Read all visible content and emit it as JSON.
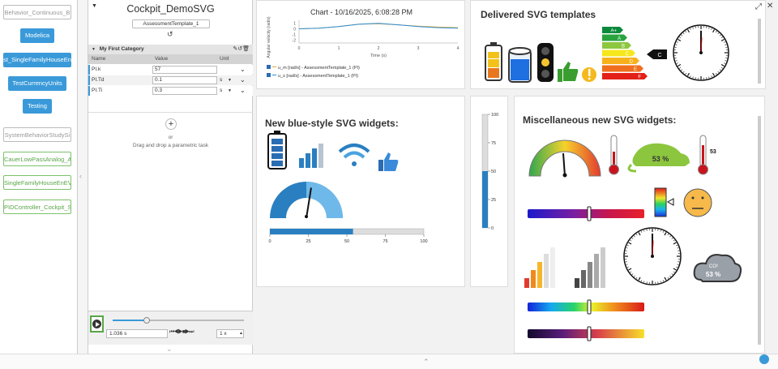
{
  "sidebar": {
    "items": [
      {
        "label": "Behavior_Continuous_B",
        "style": "gray"
      },
      {
        "label": "Modelica",
        "style": "blue"
      },
      {
        "label": "st_SingleFamilyHouseEn",
        "style": "blue"
      },
      {
        "label": "TestCurrencyUnits",
        "style": "blue"
      },
      {
        "label": "Testing",
        "style": "blue"
      },
      {
        "label": "SystemBehaviorStudySi",
        "style": "gray"
      },
      {
        "label": "CauerLowPassAnalog_A",
        "style": "green"
      },
      {
        "label": "SingleFamilyHouseEnEV",
        "style": "green"
      },
      {
        "label": "PIDController_Cockpit_S",
        "style": "green"
      }
    ]
  },
  "cockpit": {
    "title": "Cockpit_DemoSVG",
    "template": "AssessmentTemplate_1",
    "category": "My First Category",
    "columns": [
      "Name",
      "Value",
      "Unit"
    ],
    "params": [
      {
        "name": "PI.k",
        "value": "57",
        "unit": ""
      },
      {
        "name": "PI.Td",
        "value": "0.1",
        "unit": "s"
      },
      {
        "name": "PI.Ti",
        "value": "0.3",
        "unit": "s"
      }
    ],
    "drop_or": "or",
    "drop_text": "Drag and drop a parametric task",
    "time_value": "1.036 s",
    "speed": "1 x"
  },
  "chart": {
    "chart_data": {
      "type": "line",
      "title": "Chart - 10/16/2025, 6:08:28 PM",
      "xlabel": "Time (s)",
      "ylabel": "Angular velocity (rad/s)",
      "x": [
        0,
        0.5,
        1,
        1.5,
        2,
        2.5,
        3,
        3.5,
        4
      ],
      "xticks": [
        "0",
        "1",
        "2",
        "3",
        "4"
      ],
      "yticks": [
        "1",
        "0",
        "-1",
        "-2"
      ],
      "xlim": [
        0,
        4
      ],
      "ylim": [
        -2.5,
        1.5
      ],
      "series": [
        {
          "name": "u_m [rad/s] - AssessmentTemplate_1 (PI)",
          "color": "#e8a93a",
          "values": [
            0,
            0.1,
            0.4,
            0.8,
            0.9,
            0.7,
            0.45,
            0.3,
            0.2
          ]
        },
        {
          "name": "u_s [rad/s] - AssessmentTemplate_1 (PI)",
          "color": "#2a8fd6",
          "values": [
            0,
            0.1,
            0.4,
            0.8,
            0.95,
            0.7,
            0.4,
            0.2,
            0.1
          ]
        }
      ]
    }
  },
  "delivered": {
    "title": "Delivered SVG templates",
    "energy": [
      "A+",
      "A",
      "B",
      "C",
      "D",
      "E",
      "F"
    ],
    "energy_marker": "C"
  },
  "blue": {
    "title": "New blue-style SVG widgets:",
    "gauge_value": 55,
    "bar_ticks": [
      "0",
      "25",
      "50",
      "75",
      "100"
    ],
    "bar_value": 54
  },
  "vbar": {
    "ticks": [
      "100",
      "75",
      "50",
      "25",
      "0"
    ],
    "value": 50
  },
  "misc": {
    "title": "Miscellaneous new SVG widgets:",
    "thermo_value": "53",
    "eco_value": "53 %",
    "cloud_value": "53 %",
    "cloud_label": "CO²"
  },
  "colors": {
    "accent": "#3a9ad9",
    "green": "#5aa548"
  }
}
